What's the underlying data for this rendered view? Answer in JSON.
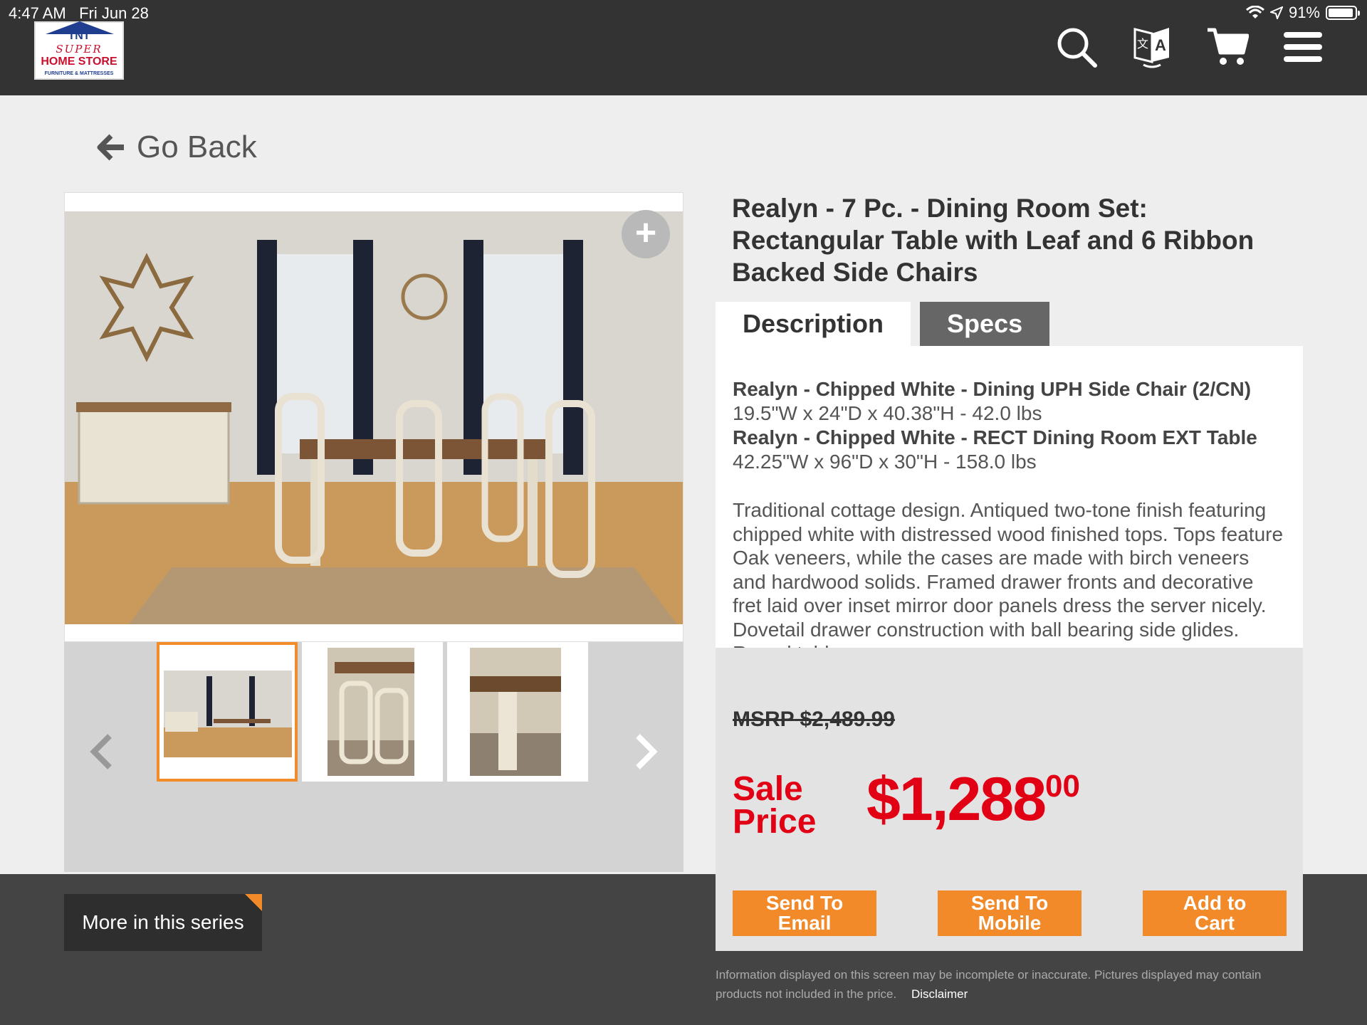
{
  "status_bar": {
    "time": "4:47 AM",
    "date": "Fri Jun 28",
    "battery": "91%"
  },
  "logo": {
    "line1": "TNT",
    "line2": "SUPER",
    "line3": "HOME STORE",
    "line4": "FURNITURE & MATTRESSES"
  },
  "nav": {
    "icons": [
      "search-icon",
      "translate-icon",
      "cart-icon",
      "menu-icon"
    ]
  },
  "go_back": {
    "label": "Go Back"
  },
  "product": {
    "title": "Realyn - 7 Pc. - Dining Room Set: Rectangular Table with Leaf and 6 Ribbon Backed Side Chairs",
    "tabs": [
      "Description",
      "Specs"
    ],
    "active_tab": "Description",
    "components": [
      {
        "name": "Realyn - Chipped White - Dining UPH Side Chair (2/CN)",
        "dims": "19.5\"W x 24\"D x 40.38\"H - 42.0 lbs"
      },
      {
        "name": "Realyn - Chipped White - RECT Dining Room EXT Table",
        "dims": "42.25\"W x 96\"D x 30\"H - 158.0 lbs"
      }
    ],
    "description": "Traditional cottage design. Antiqued two-tone finish featuring chipped white with distressed wood finished tops. Tops feature Oak veneers, while the cases are made with birch veneers and hardwood solids. Framed drawer fronts and decorative fret laid over inset mirror door panels dress the server nicely. Dovetail drawer construction with ball bearing side glides. Round table"
  },
  "pricing": {
    "msrp_label": "MSRP",
    "msrp_value": "$2,489.99",
    "sale_label_line1": "Sale",
    "sale_label_line2": "Price",
    "sale_dollars": "$1,288",
    "sale_cents": "00"
  },
  "actions": {
    "send_email_line1": "Send To",
    "send_email_line2": "Email",
    "send_mobile_line1": "Send To",
    "send_mobile_line2": "Mobile",
    "add_cart_line1": "Add to",
    "add_cart_line2": "Cart"
  },
  "series": {
    "label": "More in this series"
  },
  "footer": {
    "disclaimer_text": "Information displayed on this screen may be incomplete or inaccurate. Pictures displayed may contain products not included in the price.",
    "disclaimer_link": "Disclaimer"
  },
  "colors": {
    "topbar": "#333333",
    "accent_orange": "#f28a2a",
    "sale_red": "#e10014",
    "bottom_band": "#444444"
  }
}
